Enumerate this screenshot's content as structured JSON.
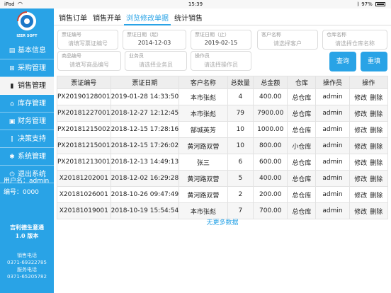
{
  "status": {
    "device": "iPad",
    "time": "15:39",
    "battery": "97%",
    "battery_level": 0.97
  },
  "brand": {
    "logo_text": "IZER SOFT"
  },
  "sidebar": {
    "items": [
      {
        "label": "基本信息",
        "icon": "document-icon"
      },
      {
        "label": "采购管理",
        "icon": "cart-icon"
      },
      {
        "label": "销售管理",
        "icon": "chart-icon",
        "active": true
      },
      {
        "label": "库存管理",
        "icon": "home-icon"
      },
      {
        "label": "财务管理",
        "icon": "finance-icon"
      },
      {
        "label": "决策支持",
        "icon": "decision-icon"
      },
      {
        "label": "系统管理",
        "icon": "gear-icon"
      },
      {
        "label": "退出系统",
        "icon": "power-icon"
      }
    ],
    "user_label": "用户名：admin",
    "code_label": "编号：0000",
    "slogan_line1": "吉利德生意通",
    "slogan_line2": "1.0 版本",
    "contacts": [
      "销售电话",
      "0371-69322785",
      "服务电话",
      "0371-65205782"
    ]
  },
  "tabs": [
    {
      "label": "销售订单"
    },
    {
      "label": "销售开单"
    },
    {
      "label": "浏览修改单据",
      "active": true
    },
    {
      "label": "统计销售"
    }
  ],
  "filters": {
    "ticket_no": {
      "label": "票证编号",
      "placeholder": "请填写票证编号"
    },
    "date_start": {
      "label": "票证日期（起）",
      "value": "2014-12-03"
    },
    "date_end": {
      "label": "票证日期（止）",
      "value": "2019-02-15"
    },
    "customer": {
      "label": "客户名称",
      "placeholder": "请选择客户"
    },
    "warehouse": {
      "label": "仓库名称",
      "placeholder": "请选择仓库名称"
    },
    "product": {
      "label": "商品编号",
      "placeholder": "请填写商品编号"
    },
    "salesman": {
      "label": "业务员",
      "placeholder": "请选择业务员"
    },
    "operator": {
      "label": "操作员",
      "placeholder": "请选择操作员"
    }
  },
  "buttons": {
    "query": "查询",
    "reset": "重填"
  },
  "table": {
    "headers": [
      "票证编号",
      "票证日期",
      "客户名称",
      "总数量",
      "总金额",
      "仓库",
      "操作员",
      "操作"
    ],
    "rows": [
      {
        "no": "PX20190128001",
        "date": "2019-01-28 14:33:50",
        "customer": "本市张彪",
        "qty": "4",
        "amount": "400.00",
        "warehouse": "总仓库",
        "operator": "admin"
      },
      {
        "no": "PX20181227001",
        "date": "2018-12-27 12:12:45",
        "customer": "本市张彪",
        "qty": "79",
        "amount": "7900.00",
        "warehouse": "总仓库",
        "operator": "admin"
      },
      {
        "no": "PX20181215002",
        "date": "2018-12-15 17:28:16",
        "customer": "郜城英芳",
        "qty": "10",
        "amount": "1000.00",
        "warehouse": "总仓库",
        "operator": "admin"
      },
      {
        "no": "PX20181215001",
        "date": "2018-12-15 17:26:02",
        "customer": "黄河路双营",
        "qty": "10",
        "amount": "800.00",
        "warehouse": "小仓库",
        "operator": "admin"
      },
      {
        "no": "PX20181213001",
        "date": "2018-12-13 14:49:13",
        "customer": "张三",
        "qty": "6",
        "amount": "600.00",
        "warehouse": "总仓库",
        "operator": "admin"
      },
      {
        "no": "X20181202001",
        "date": "2018-12-02 16:29:28",
        "customer": "黄河路双营",
        "qty": "5",
        "amount": "400.00",
        "warehouse": "总仓库",
        "operator": "admin"
      },
      {
        "no": "X20181026001",
        "date": "2018-10-26 09:47:49",
        "customer": "黄河路双营",
        "qty": "2",
        "amount": "200.00",
        "warehouse": "总仓库",
        "operator": "admin"
      },
      {
        "no": "X20181019001",
        "date": "2018-10-19 15:54:54",
        "customer": "本市张彪",
        "qty": "7",
        "amount": "700.00",
        "warehouse": "总仓库",
        "operator": "admin"
      }
    ],
    "action_edit": "修改",
    "action_delete": "删除"
  },
  "more_text": "无更多数据",
  "colors": {
    "accent": "#29a3e6",
    "sidebar_bg": "#29a3e6",
    "header_bg": "#eeeeee"
  }
}
